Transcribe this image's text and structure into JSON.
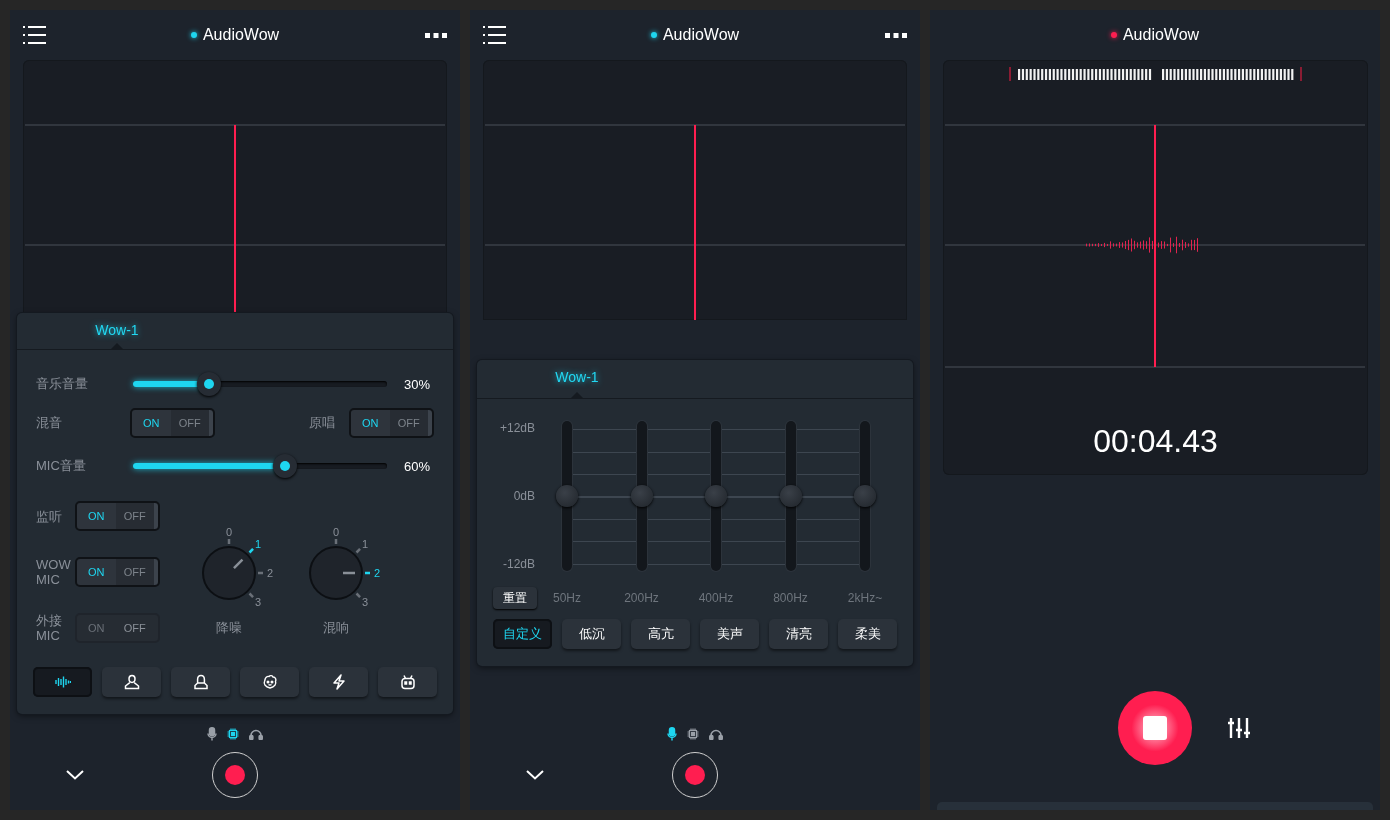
{
  "screens": [
    {
      "kind": "mixer",
      "header": {
        "title": "AudioWow",
        "color": "#1ed6f0",
        "menu": true,
        "more": true
      },
      "panel": {
        "tab": "Wow-1",
        "music_volume": {
          "label": "音乐音量",
          "level": 0.3,
          "reading": "30%"
        },
        "switches": [
          {
            "label": "混音",
            "on": true,
            "on_label": "ON",
            "off_label": "OFF"
          },
          {
            "label": "原唱",
            "on": true,
            "on_label": "ON",
            "off_label": "OFF"
          }
        ],
        "mic_volume": {
          "label": "MIC音量",
          "level": 0.6,
          "reading": "60%"
        },
        "inputs": [
          {
            "label": "监听",
            "on": true,
            "disabled": false,
            "on_label": "ON",
            "off_label": "OFF"
          },
          {
            "label": "WOW MIC",
            "on": true,
            "disabled": false,
            "on_label": "ON",
            "off_label": "OFF"
          },
          {
            "label": "外接 MIC",
            "on": false,
            "disabled": true,
            "on_label": "ON",
            "off_label": "OFF"
          }
        ],
        "knobs": [
          {
            "label": "降噪",
            "ticks": [
              {
                "label": "0",
                "selected": false
              },
              {
                "label": "1",
                "selected": true
              },
              {
                "label": "2",
                "selected": false
              },
              {
                "label": "3",
                "selected": false
              }
            ]
          },
          {
            "label": "混响",
            "ticks": [
              {
                "label": "0",
                "selected": false
              },
              {
                "label": "1",
                "selected": false
              },
              {
                "label": "2",
                "selected": true
              },
              {
                "label": "3",
                "selected": false
              }
            ]
          }
        ],
        "modes": [
          {
            "selected": true
          },
          {
            "selected": false
          },
          {
            "selected": false
          },
          {
            "selected": false
          },
          {
            "selected": false
          },
          {
            "selected": false
          }
        ]
      },
      "sources": [
        {
          "selected": false
        },
        {
          "selected": true
        },
        {
          "selected": false
        }
      ]
    },
    {
      "kind": "equalizer",
      "header": {
        "title": "AudioWow",
        "color": "#1ed6f0",
        "menu": true,
        "more": true
      },
      "panel": {
        "tab": "Wow-1",
        "db_labels": [
          "+12dB",
          "0dB",
          "-12dB"
        ],
        "bands": [
          {
            "label": "50Hz",
            "level": 0.5
          },
          {
            "label": "200Hz",
            "level": 0.5
          },
          {
            "label": "400Hz",
            "level": 0.5
          },
          {
            "label": "800Hz",
            "level": 0.5
          },
          {
            "label": "2kHz~",
            "level": 0.5
          }
        ],
        "reset": "重置",
        "presets": [
          {
            "label": "自定义",
            "selected": true
          },
          {
            "label": "低沉",
            "selected": false
          },
          {
            "label": "高亢",
            "selected": false
          },
          {
            "label": "美声",
            "selected": false
          },
          {
            "label": "清亮",
            "selected": false
          },
          {
            "label": "柔美",
            "selected": false
          }
        ]
      },
      "sources": [
        {
          "selected": true
        },
        {
          "selected": false
        },
        {
          "selected": false
        }
      ]
    },
    {
      "kind": "recorder",
      "header": {
        "title": "AudioWow",
        "color": "#ff1e50"
      },
      "timer": "00:04.43"
    }
  ]
}
